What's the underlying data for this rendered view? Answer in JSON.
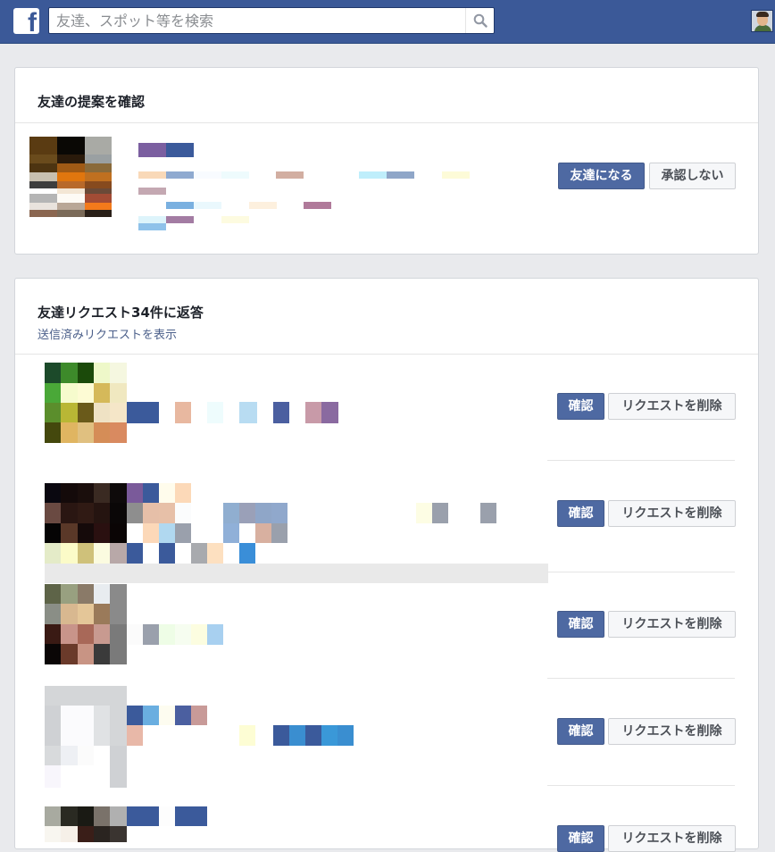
{
  "search": {
    "placeholder": "友達、スポット等を検索"
  },
  "suggestions": {
    "title": "友達の提案を確認",
    "confirm_label": "友達になる",
    "reject_label": "承認しない"
  },
  "requests": {
    "title": "友達リクエスト34件に返答",
    "sent_link": "送信済みリクエストを表示",
    "confirm_label": "確認",
    "delete_label": "リクエストを削除"
  },
  "icons": {
    "logo": "facebook-logo-icon",
    "search": "search-icon",
    "profile": "profile-avatar"
  },
  "colors": {
    "brand": "#3b5998",
    "primary_button": "#4e69a2",
    "page_bg": "#e9eaed"
  }
}
